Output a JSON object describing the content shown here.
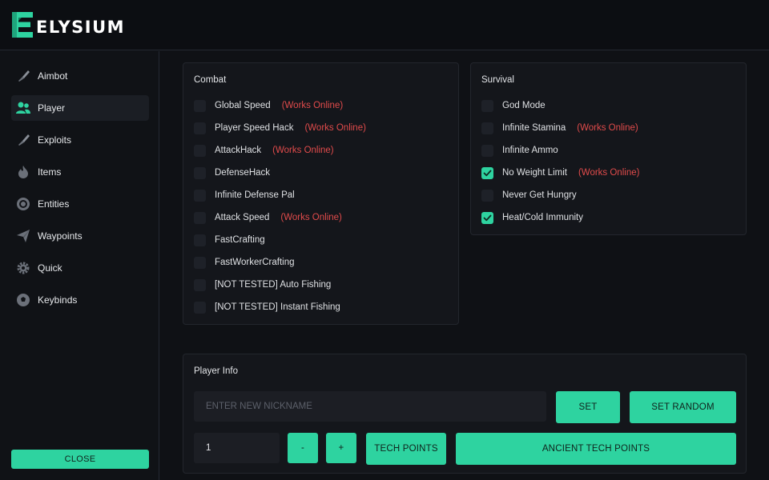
{
  "app": {
    "brand": "ELYSIUM",
    "logo_icon": "elysium-e-logo",
    "accent": "#2ed3a0",
    "warning_color": "#e14b4b"
  },
  "sidebar": {
    "items": [
      {
        "label": "Aimbot",
        "icon": "knife-icon",
        "active": false
      },
      {
        "label": "Player",
        "icon": "users-icon",
        "active": true
      },
      {
        "label": "Exploits",
        "icon": "knife-icon",
        "active": false
      },
      {
        "label": "Items",
        "icon": "fire-icon",
        "active": false
      },
      {
        "label": "Entities",
        "icon": "target-icon",
        "active": false
      },
      {
        "label": "Waypoints",
        "icon": "paper-plane-icon",
        "active": false
      },
      {
        "label": "Quick",
        "icon": "gear-icon",
        "active": false
      },
      {
        "label": "Keybinds",
        "icon": "soccer-ball-icon",
        "active": false
      }
    ],
    "close_label": "CLOSE"
  },
  "combat": {
    "title": "Combat",
    "items": [
      {
        "label": "Global Speed",
        "note": "(Works Online)",
        "checked": false
      },
      {
        "label": "Player Speed Hack",
        "note": "(Works Online)",
        "checked": false
      },
      {
        "label": "AttackHack",
        "note": "(Works Online)",
        "checked": false
      },
      {
        "label": "DefenseHack",
        "note": "",
        "checked": false
      },
      {
        "label": "Infinite Defense Pal",
        "note": "",
        "checked": false
      },
      {
        "label": "Attack Speed",
        "note": "(Works Online)",
        "checked": false
      },
      {
        "label": "FastCrafting",
        "note": "",
        "checked": false
      },
      {
        "label": "FastWorkerCrafting",
        "note": "",
        "checked": false
      },
      {
        "label": "[NOT TESTED] Auto Fishing",
        "note": "",
        "checked": false
      },
      {
        "label": "[NOT TESTED] Instant Fishing",
        "note": "",
        "checked": false
      }
    ]
  },
  "survival": {
    "title": "Survival",
    "items": [
      {
        "label": "God Mode",
        "note": "",
        "checked": false
      },
      {
        "label": "Infinite Stamina",
        "note": "(Works Online)",
        "checked": false
      },
      {
        "label": "Infinite Ammo",
        "note": "",
        "checked": false
      },
      {
        "label": "No Weight Limit",
        "note": "(Works Online)",
        "checked": true
      },
      {
        "label": "Never Get Hungry",
        "note": "",
        "checked": false
      },
      {
        "label": "Heat/Cold Immunity",
        "note": "",
        "checked": true
      }
    ]
  },
  "player_info": {
    "title": "Player Info",
    "nickname_placeholder": "ENTER NEW NICKNAME",
    "nickname_value": "",
    "set_label": "SET",
    "set_random_label": "SET RANDOM",
    "quantity_value": "1",
    "minus_label": "-",
    "plus_label": "+",
    "tech_points_label": "TECH POINTS",
    "ancient_tech_points_label": "ANCIENT TECH POINTS"
  }
}
